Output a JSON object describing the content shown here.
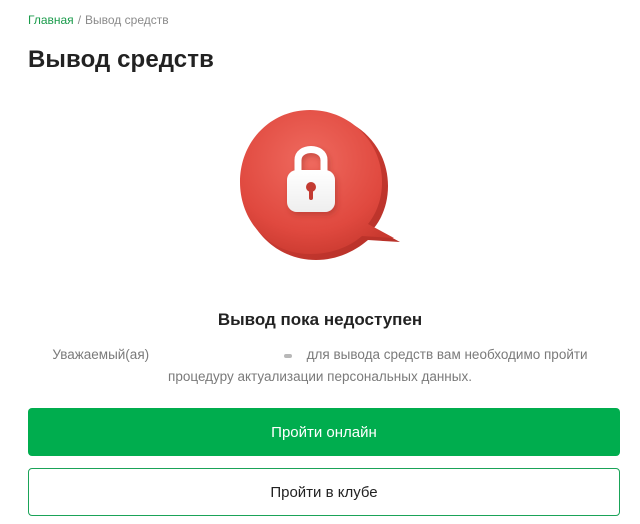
{
  "breadcrumb": {
    "home_label": "Главная",
    "separator": "/",
    "current_label": "Вывод средств"
  },
  "page": {
    "title": "Вывод средств"
  },
  "illustration": {
    "icon": "lock-speech-bubble-icon",
    "bubble_color": "#e5544b",
    "lock_color": "#ffffff"
  },
  "status": {
    "heading": "Вывод пока недоступен",
    "message_prefix": "Уважаемый(ая)",
    "message_suffix": "для вывода средств вам необходимо пройти процедуру актуализации персональных данных."
  },
  "actions": {
    "primary_label": "Пройти онлайн",
    "secondary_label": "Пройти в клубе"
  },
  "colors": {
    "accent": "#00ad4e",
    "link": "#1a9b4b",
    "muted_text": "#7a7a7a"
  }
}
